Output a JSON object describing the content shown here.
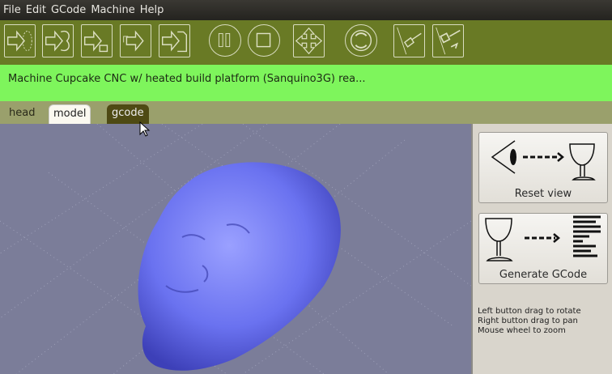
{
  "menu": [
    "File",
    "Edit",
    "GCode",
    "Machine",
    "Help"
  ],
  "toolbar": {
    "buttons": [
      "load-outline",
      "load-shape",
      "load-build",
      "load-multi",
      "load-file",
      "pause",
      "stop",
      "jog",
      "rotate",
      "disconnect",
      "connect"
    ]
  },
  "status": "Machine Cupcake CNC w/ heated build platform (Sanquino3G) rea...",
  "tabs": {
    "head": "head",
    "model": "model",
    "gcode": "gcode"
  },
  "panel": {
    "reset_view": "Reset view",
    "generate_gcode": "Generate GCode",
    "help": [
      "Left button drag to rotate",
      "Right button drag to pan",
      "Mouse wheel to zoom"
    ]
  },
  "colors": {
    "toolbar": "#697a25",
    "status": "#7ef55c",
    "model": "#6a72f0"
  }
}
